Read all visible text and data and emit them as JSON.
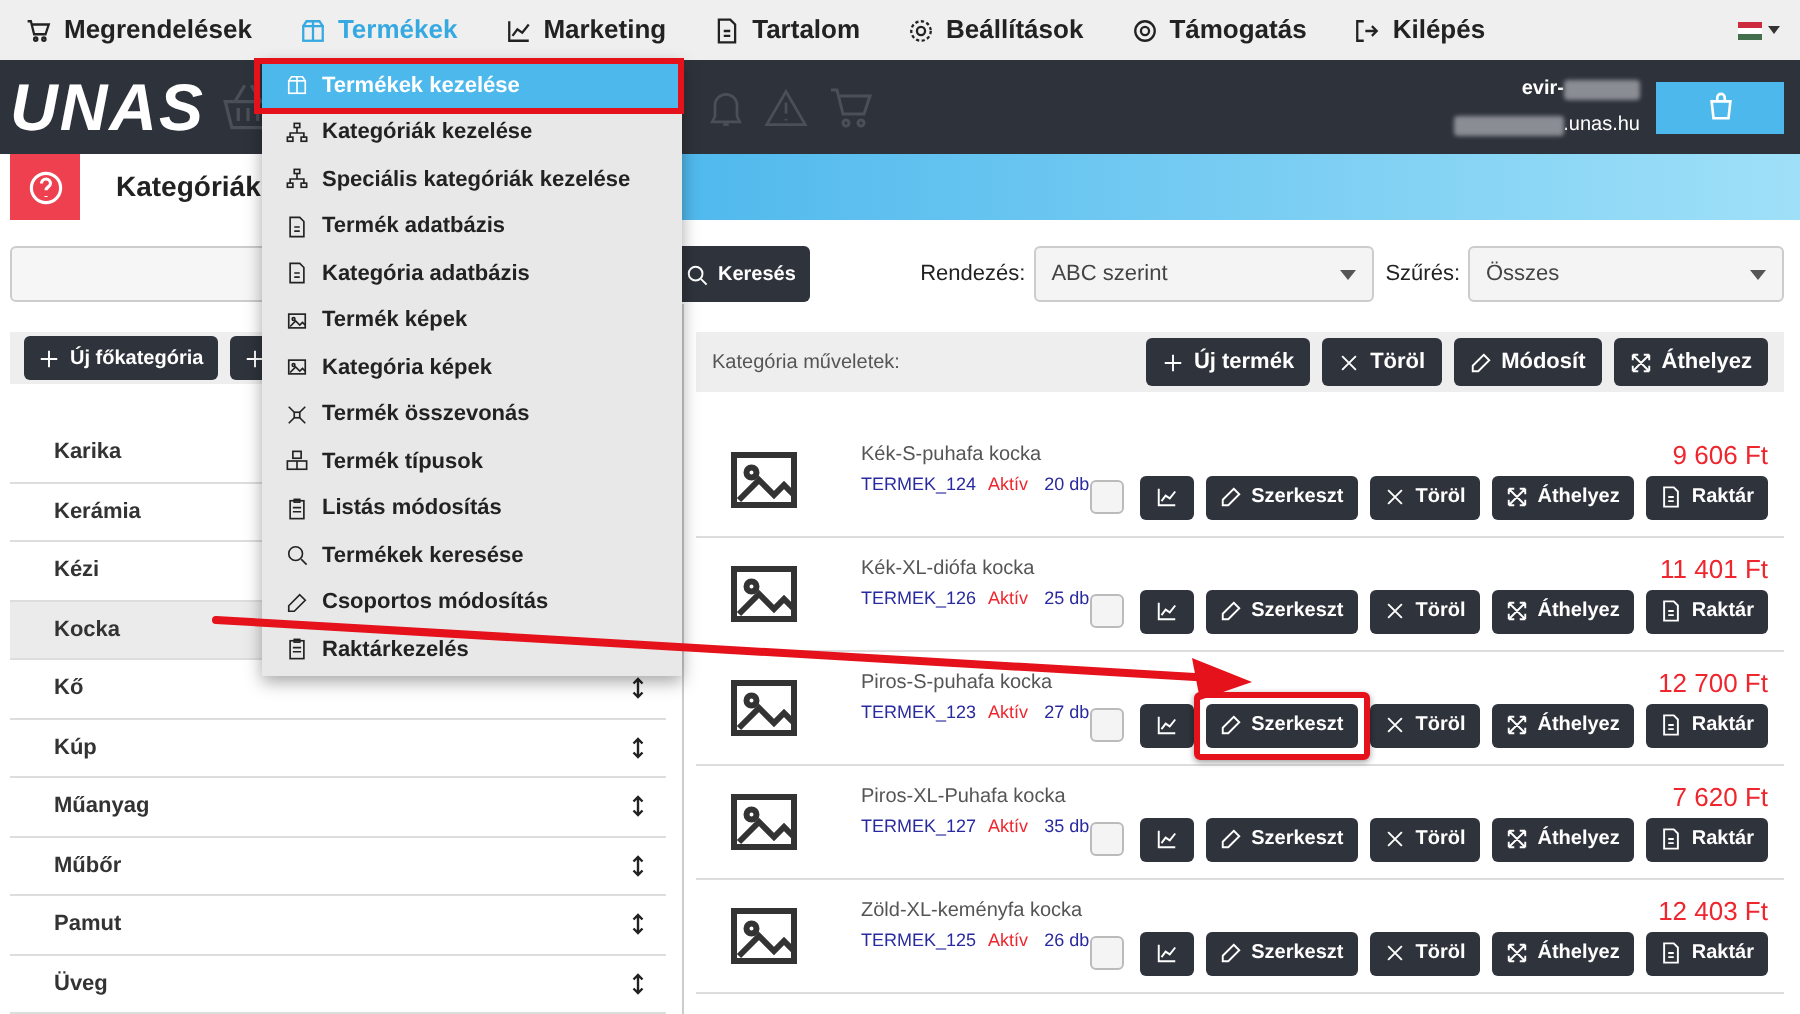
{
  "nav": {
    "items": [
      {
        "label": "Megrendelések",
        "selected": false
      },
      {
        "label": "Termékek",
        "selected": true
      },
      {
        "label": "Marketing",
        "selected": false
      },
      {
        "label": "Tartalom",
        "selected": false
      },
      {
        "label": "Beállítások",
        "selected": false
      },
      {
        "label": "Támogatás",
        "selected": false
      },
      {
        "label": "Kilépés",
        "selected": false
      }
    ]
  },
  "header": {
    "logo": "UNAS",
    "user": "evir-",
    "domain": ".unas.hu"
  },
  "page_title": "Kategóriák",
  "search": {
    "button": "Keresés",
    "sort_label": "Rendezés:",
    "sort_value": "ABC szerint",
    "filter_label": "Szűrés:",
    "filter_value": "Összes"
  },
  "left_buttons": [
    {
      "kind": "text",
      "label": "Új főkategória"
    },
    {
      "kind": "icon"
    }
  ],
  "categories": [
    {
      "name": "Karika",
      "selected": false
    },
    {
      "name": "Kerámia",
      "selected": false
    },
    {
      "name": "Kézi",
      "selected": false
    },
    {
      "name": "Kocka",
      "selected": true
    },
    {
      "name": "Kő",
      "selected": false,
      "handle": true
    },
    {
      "name": "Kúp",
      "selected": false,
      "handle": true
    },
    {
      "name": "Műanyag",
      "selected": false,
      "handle": true
    },
    {
      "name": "Műbőr",
      "selected": false,
      "handle": true
    },
    {
      "name": "Pamut",
      "selected": false,
      "handle": true
    },
    {
      "name": "Üveg",
      "selected": false,
      "handle": true
    }
  ],
  "category_ops": {
    "label": "Kategória műveletek:",
    "buttons": [
      "Új termék",
      "Töröl",
      "Módosít",
      "Áthelyez"
    ]
  },
  "products": [
    {
      "name": "Kék-S-puhafa kocka",
      "code": "TERMEK_124",
      "status": "Aktív",
      "qty": "20 db",
      "price": "9 606 Ft",
      "checked": false,
      "buttons": [
        {
          "label": "Szerkeszt",
          "highlighted": false
        },
        {
          "label": "Töröl",
          "highlighted": false
        },
        {
          "label": "Áthelyez",
          "highlighted": false
        },
        {
          "label": "Raktár",
          "highlighted": false
        }
      ]
    },
    {
      "name": "Kék-XL-diófa kocka",
      "code": "TERMEK_126",
      "status": "Aktív",
      "qty": "25 db",
      "price": "11 401 Ft",
      "checked": false,
      "buttons": [
        {
          "label": "Szerkeszt",
          "highlighted": false
        },
        {
          "label": "Töröl",
          "highlighted": false
        },
        {
          "label": "Áthelyez",
          "highlighted": false
        },
        {
          "label": "Raktár",
          "highlighted": false
        }
      ]
    },
    {
      "name": "Piros-S-puhafa kocka",
      "code": "TERMEK_123",
      "status": "Aktív",
      "qty": "27 db",
      "price": "12 700 Ft",
      "checked": false,
      "buttons": [
        {
          "label": "Szerkeszt",
          "highlighted": true
        },
        {
          "label": "Töröl",
          "highlighted": false
        },
        {
          "label": "Áthelyez",
          "highlighted": false
        },
        {
          "label": "Raktár",
          "highlighted": false
        }
      ]
    },
    {
      "name": "Piros-XL-Puhafa kocka",
      "code": "TERMEK_127",
      "status": "Aktív",
      "qty": "35 db",
      "price": "7 620 Ft",
      "checked": false,
      "buttons": [
        {
          "label": "Szerkeszt",
          "highlighted": false
        },
        {
          "label": "Töröl",
          "highlighted": false
        },
        {
          "label": "Áthelyez",
          "highlighted": false
        },
        {
          "label": "Raktár",
          "highlighted": false
        }
      ]
    },
    {
      "name": "Zöld-XL-keményfa kocka",
      "code": "TERMEK_125",
      "status": "Aktív",
      "qty": "26 db",
      "price": "12 403 Ft",
      "checked": false,
      "buttons": [
        {
          "label": "Szerkeszt",
          "highlighted": false
        },
        {
          "label": "Töröl",
          "highlighted": false
        },
        {
          "label": "Áthelyez",
          "highlighted": false
        },
        {
          "label": "Raktár",
          "highlighted": false
        }
      ]
    }
  ],
  "menu": {
    "items": [
      {
        "label": "Termékek kezelése",
        "selected": true,
        "highlighted": true
      },
      {
        "label": "Kategóriák kezelése",
        "selected": false,
        "highlighted": false
      },
      {
        "label": "Speciális kategóriák kezelése",
        "selected": false,
        "highlighted": false
      },
      {
        "label": "Termék adatbázis",
        "selected": false,
        "highlighted": false
      },
      {
        "label": "Kategória adatbázis",
        "selected": false,
        "highlighted": false
      },
      {
        "label": "Termék képek",
        "selected": false,
        "highlighted": false
      },
      {
        "label": "Kategória képek",
        "selected": false,
        "highlighted": false
      },
      {
        "label": "Termék összevonás",
        "selected": false,
        "highlighted": false
      },
      {
        "label": "Termék típusok",
        "selected": false,
        "highlighted": false
      },
      {
        "label": "Listás módosítás",
        "selected": false,
        "highlighted": false
      },
      {
        "label": "Termékek keresése",
        "selected": false,
        "highlighted": false
      },
      {
        "label": "Csoportos módosítás",
        "selected": false,
        "highlighted": false
      },
      {
        "label": "Raktárkezelés",
        "selected": false,
        "highlighted": false
      }
    ]
  }
}
